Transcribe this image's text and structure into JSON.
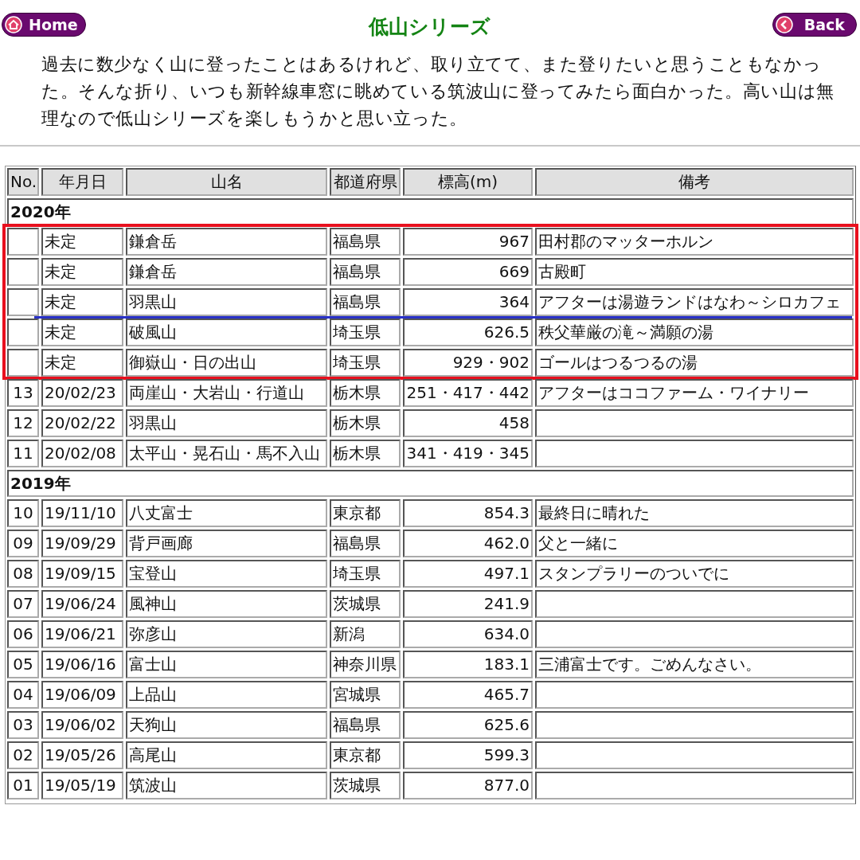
{
  "header": {
    "home_button": "Home",
    "title": "低山シリーズ",
    "back_button": "Back"
  },
  "intro": "過去に数少なく山に登ったことはあるけれど、取り立てて、また登りたいと思うこともなかった。そんな折り、いつも新幹線車窓に眺めている筑波山に登ってみたら面白かった。高い山は無理なので低山シリーズを楽しもうかと思い立った。",
  "table": {
    "columns": [
      "No.",
      "年月日",
      "山名",
      "都道府県",
      "標高(m)",
      "備考"
    ],
    "sections": [
      {
        "year": "2020年",
        "rows": [
          {
            "date": "未定",
            "name": "鎌倉岳",
            "prefecture": "福島県",
            "elevation": "967",
            "note": "田村郡のマッターホルン",
            "highlighted": true,
            "divider_after": false
          },
          {
            "date": "未定",
            "name": "鎌倉岳",
            "prefecture": "福島県",
            "elevation": "669",
            "note": "古殿町",
            "highlighted": true,
            "divider_after": false
          },
          {
            "date": "未定",
            "name": "羽黒山",
            "prefecture": "福島県",
            "elevation": "364",
            "note": "アフターは湯遊ランドはなわ～シロカフェ",
            "highlighted": true,
            "divider_after": true
          },
          {
            "date": "未定",
            "name": "破風山",
            "prefecture": "埼玉県",
            "elevation": "626.5",
            "note": "秩父華厳の滝～満願の湯",
            "highlighted": true,
            "divider_after": false
          },
          {
            "date": "未定",
            "name": "御嶽山・日の出山",
            "prefecture": "埼玉県",
            "elevation": "929・902",
            "note": "ゴールはつるつるの湯",
            "highlighted": true,
            "divider_after": false
          },
          {
            "no": "13",
            "date": "20/02/23",
            "name": "両崖山・大岩山・行道山",
            "prefecture": "栃木県",
            "elevation": "251・417・442",
            "note": "アフターはココファーム・ワイナリー",
            "highlighted": false,
            "divider_after": false
          },
          {
            "no": "12",
            "date": "20/02/22",
            "name": "羽黒山",
            "prefecture": "栃木県",
            "elevation": "458",
            "highlighted": false,
            "divider_after": false
          },
          {
            "no": "11",
            "date": "20/02/08",
            "name": "太平山・晃石山・馬不入山",
            "prefecture": "栃木県",
            "elevation": "341・419・345",
            "highlighted": false,
            "divider_after": false
          }
        ]
      },
      {
        "year": "2019年",
        "rows": [
          {
            "no": "10",
            "date": "19/11/10",
            "name": "八丈富士",
            "prefecture": "東京都",
            "elevation": "854.3",
            "note": "最終日に晴れた",
            "highlighted": false,
            "divider_after": false
          },
          {
            "no": "09",
            "date": "19/09/29",
            "name": "背戸画廊",
            "prefecture": "福島県",
            "elevation": "462.0",
            "note": "父と一緒に",
            "highlighted": false,
            "divider_after": false
          },
          {
            "no": "08",
            "date": "19/09/15",
            "name": "宝登山",
            "prefecture": "埼玉県",
            "elevation": "497.1",
            "note": "スタンプラリーのついでに",
            "highlighted": false,
            "divider_after": false
          },
          {
            "no": "07",
            "date": "19/06/24",
            "name": "風神山",
            "prefecture": "茨城県",
            "elevation": "241.9",
            "highlighted": false,
            "divider_after": false
          },
          {
            "no": "06",
            "date": "19/06/21",
            "name": "弥彦山",
            "prefecture": "新潟",
            "elevation": "634.0",
            "highlighted": false,
            "divider_after": false
          },
          {
            "no": "05",
            "date": "19/06/16",
            "name": "富士山",
            "prefecture": "神奈川県",
            "elevation": "183.1",
            "note": "三浦富士です。ごめんなさい。",
            "highlighted": false,
            "divider_after": false
          },
          {
            "no": "04",
            "date": "19/06/09",
            "name": "上品山",
            "prefecture": "宮城県",
            "elevation": "465.7",
            "highlighted": false,
            "divider_after": false
          },
          {
            "no": "03",
            "date": "19/06/02",
            "name": "天狗山",
            "prefecture": "福島県",
            "elevation": "625.6",
            "highlighted": false,
            "divider_after": false
          },
          {
            "no": "02",
            "date": "19/05/26",
            "name": "高尾山",
            "prefecture": "東京都",
            "elevation": "599.3",
            "highlighted": false,
            "divider_after": false
          },
          {
            "no": "01",
            "date": "19/05/19",
            "name": "筑波山",
            "prefecture": "茨城県",
            "elevation": "877.0",
            "highlighted": false,
            "divider_after": false
          }
        ]
      }
    ]
  }
}
